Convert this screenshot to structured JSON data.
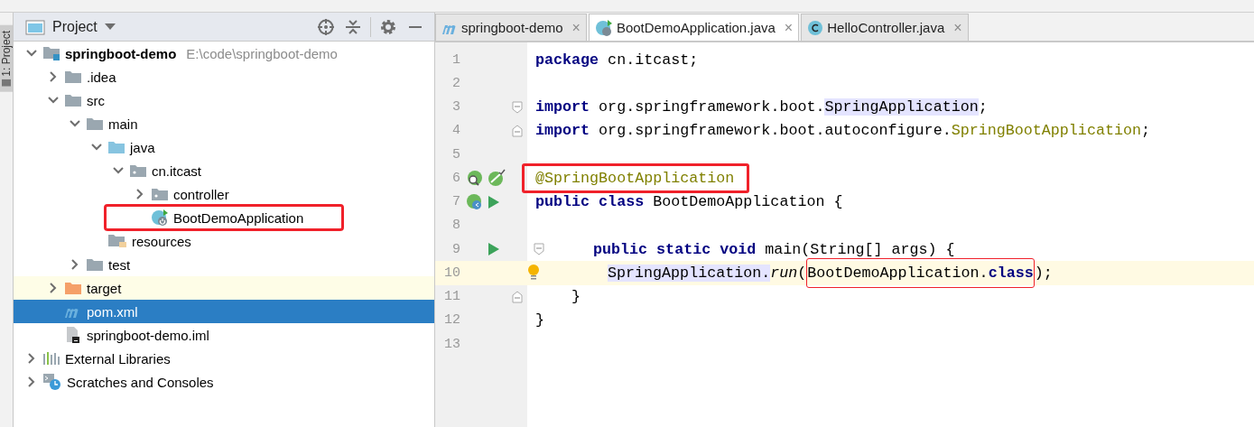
{
  "side_strip": {
    "label": "1: Project"
  },
  "project_panel": {
    "title": "Project",
    "tree": [
      {
        "label": "springboot-demo",
        "kind": "module",
        "path": "E:\\code\\springboot-demo",
        "expanded": true,
        "selected": false,
        "children": [
          {
            "label": ".idea",
            "kind": "folder",
            "expanded": false,
            "selected": false
          },
          {
            "label": "src",
            "kind": "folder",
            "expanded": true,
            "selected": false,
            "children": [
              {
                "label": "main",
                "kind": "folder",
                "expanded": true,
                "selected": false,
                "children": [
                  {
                    "label": "java",
                    "kind": "source_folder",
                    "expanded": true,
                    "selected": false,
                    "children": [
                      {
                        "label": "cn.itcast",
                        "kind": "package",
                        "expanded": true,
                        "selected": false,
                        "children": [
                          {
                            "label": "controller",
                            "kind": "package",
                            "expanded": false,
                            "selected": false
                          },
                          {
                            "label": "BootDemoApplication",
                            "kind": "spring_class",
                            "selected": false,
                            "marked": true
                          }
                        ]
                      }
                    ]
                  },
                  {
                    "label": "resources",
                    "kind": "resources_folder",
                    "selected": false
                  }
                ]
              },
              {
                "label": "test",
                "kind": "folder",
                "expanded": false,
                "selected": false
              }
            ]
          },
          {
            "label": "target",
            "kind": "excluded_folder",
            "expanded": false,
            "selected": false
          },
          {
            "label": "pom.xml",
            "kind": "maven_file",
            "selected": true
          },
          {
            "label": "springboot-demo.iml",
            "kind": "iml_file",
            "selected": false
          }
        ]
      },
      {
        "label": "External Libraries",
        "kind": "libraries",
        "expanded": false,
        "selected": false
      },
      {
        "label": "Scratches and Consoles",
        "kind": "scratches",
        "expanded": false,
        "selected": false
      }
    ]
  },
  "editor": {
    "tabs": [
      {
        "label": "springboot-demo",
        "kind": "maven",
        "selected": false,
        "close": "×"
      },
      {
        "label": "BootDemoApplication.java",
        "kind": "spring",
        "selected": true,
        "close": "×"
      },
      {
        "label": "HelloController.java",
        "kind": "class",
        "selected": false,
        "close": "×"
      }
    ],
    "lines": [
      {
        "number": "1",
        "tokens": [
          {
            "text": "package",
            "kind": "keyword"
          },
          {
            "text": " cn.itcast;",
            "kind": "plain"
          }
        ]
      },
      {
        "number": "2"
      },
      {
        "number": "3",
        "markers": [
          {
            "kind": "fold-start"
          }
        ],
        "tokens": [
          {
            "text": "import",
            "kind": "keyword"
          },
          {
            "text": " org.springframework.boot.",
            "kind": "plain"
          },
          {
            "text": "SpringApplication",
            "kind": "usage"
          },
          {
            "text": ";",
            "kind": "plain"
          }
        ]
      },
      {
        "number": "4",
        "markers": [
          {
            "kind": "fold-end"
          }
        ],
        "tokens": [
          {
            "text": "import",
            "kind": "keyword"
          },
          {
            "text": " org.springframework.boot.autoconfigure.",
            "kind": "plain"
          },
          {
            "text": "SpringBootApplication",
            "kind": "annotation"
          },
          {
            "text": ";",
            "kind": "plain"
          }
        ]
      },
      {
        "number": "5"
      },
      {
        "number": "6",
        "markers": [
          {
            "kind": "bean-find"
          },
          {
            "kind": "bean-check"
          }
        ],
        "tokens": [
          {
            "kind": "highlight",
            "tokens": [
              {
                "text": "@SpringBootApplication",
                "kind": "annotation"
              }
            ]
          }
        ]
      },
      {
        "number": "7",
        "markers": [
          {
            "kind": "bean-run"
          },
          {
            "kind": "run"
          }
        ],
        "tokens": [
          {
            "text": "public class",
            "kind": "keyword"
          },
          {
            "text": " BootDemoApplication {",
            "kind": "plain"
          }
        ]
      },
      {
        "number": "8"
      },
      {
        "number": "9",
        "kind": "member",
        "markers": [
          {
            "kind": "run"
          },
          {
            "kind": "fold-start"
          }
        ],
        "tokens": [
          {
            "text": "public static void",
            "kind": "keyword"
          },
          {
            "text": " main(String[] args) {",
            "kind": "plain"
          }
        ]
      },
      {
        "number": "10",
        "kind": "body",
        "current": true,
        "intention": true,
        "tokens": [
          {
            "text": "SpringApplication.",
            "kind": "usage"
          },
          {
            "text": "run",
            "kind": "static_call"
          },
          {
            "text": "(",
            "kind": "plain"
          },
          {
            "kind": "outline",
            "tokens": [
              {
                "text": "BootDemoApplication.",
                "kind": "plain"
              },
              {
                "text": "class",
                "kind": "keyword"
              }
            ]
          },
          {
            "text": ");",
            "kind": "plain"
          }
        ]
      },
      {
        "number": "11",
        "kind": "member",
        "markers": [
          {
            "kind": "fold-end"
          }
        ],
        "tokens": [
          {
            "text": "}",
            "kind": "plain"
          }
        ]
      },
      {
        "number": "12",
        "tokens": [
          {
            "text": "}",
            "kind": "plain"
          }
        ]
      },
      {
        "number": "13"
      }
    ]
  }
}
